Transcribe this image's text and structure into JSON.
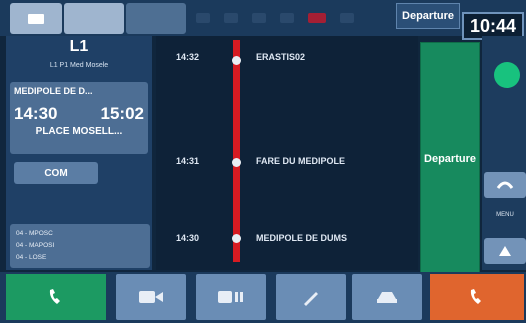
{
  "header": {
    "departure_label": "Departure",
    "clock": "10:44"
  },
  "status_icons": [
    "battery-icon",
    "signal-icon",
    "wifi-icon",
    "alert-icon",
    "phone-icon"
  ],
  "left_panel": {
    "line": "L1",
    "route_text": "L1 P1 Med Mosele",
    "destination": "MEDIPOLE DE D...",
    "time_scheduled": "14:30",
    "time_estimated": "15:02",
    "stop": "PLACE MOSELL...",
    "com_label": "COM",
    "messages": [
      "04 - MPOSC",
      "04 - MAPOSI",
      "04 - LOSE"
    ]
  },
  "timeline": {
    "stops": [
      {
        "time": "14:32",
        "name": "ERASTIS02"
      },
      {
        "time": "14:31",
        "name": "FARE DU MEDIPOLE"
      },
      {
        "time": "14:30",
        "name": "MEDIPOLE DE DUMS"
      }
    ]
  },
  "departure_button": "Departure",
  "right_strip": {
    "label": "MENU"
  },
  "bottom_bar": {
    "call_icon": "phone-icon",
    "icons": [
      "camera-icon",
      "video-icon",
      "pen-icon",
      "vehicle-icon"
    ],
    "hangup_icon": "phone-icon"
  },
  "colors": {
    "accent_green": "#178a5e",
    "track_red": "#d61b22",
    "hangup_orange": "#e0652e",
    "call_green": "#1c9a62"
  }
}
